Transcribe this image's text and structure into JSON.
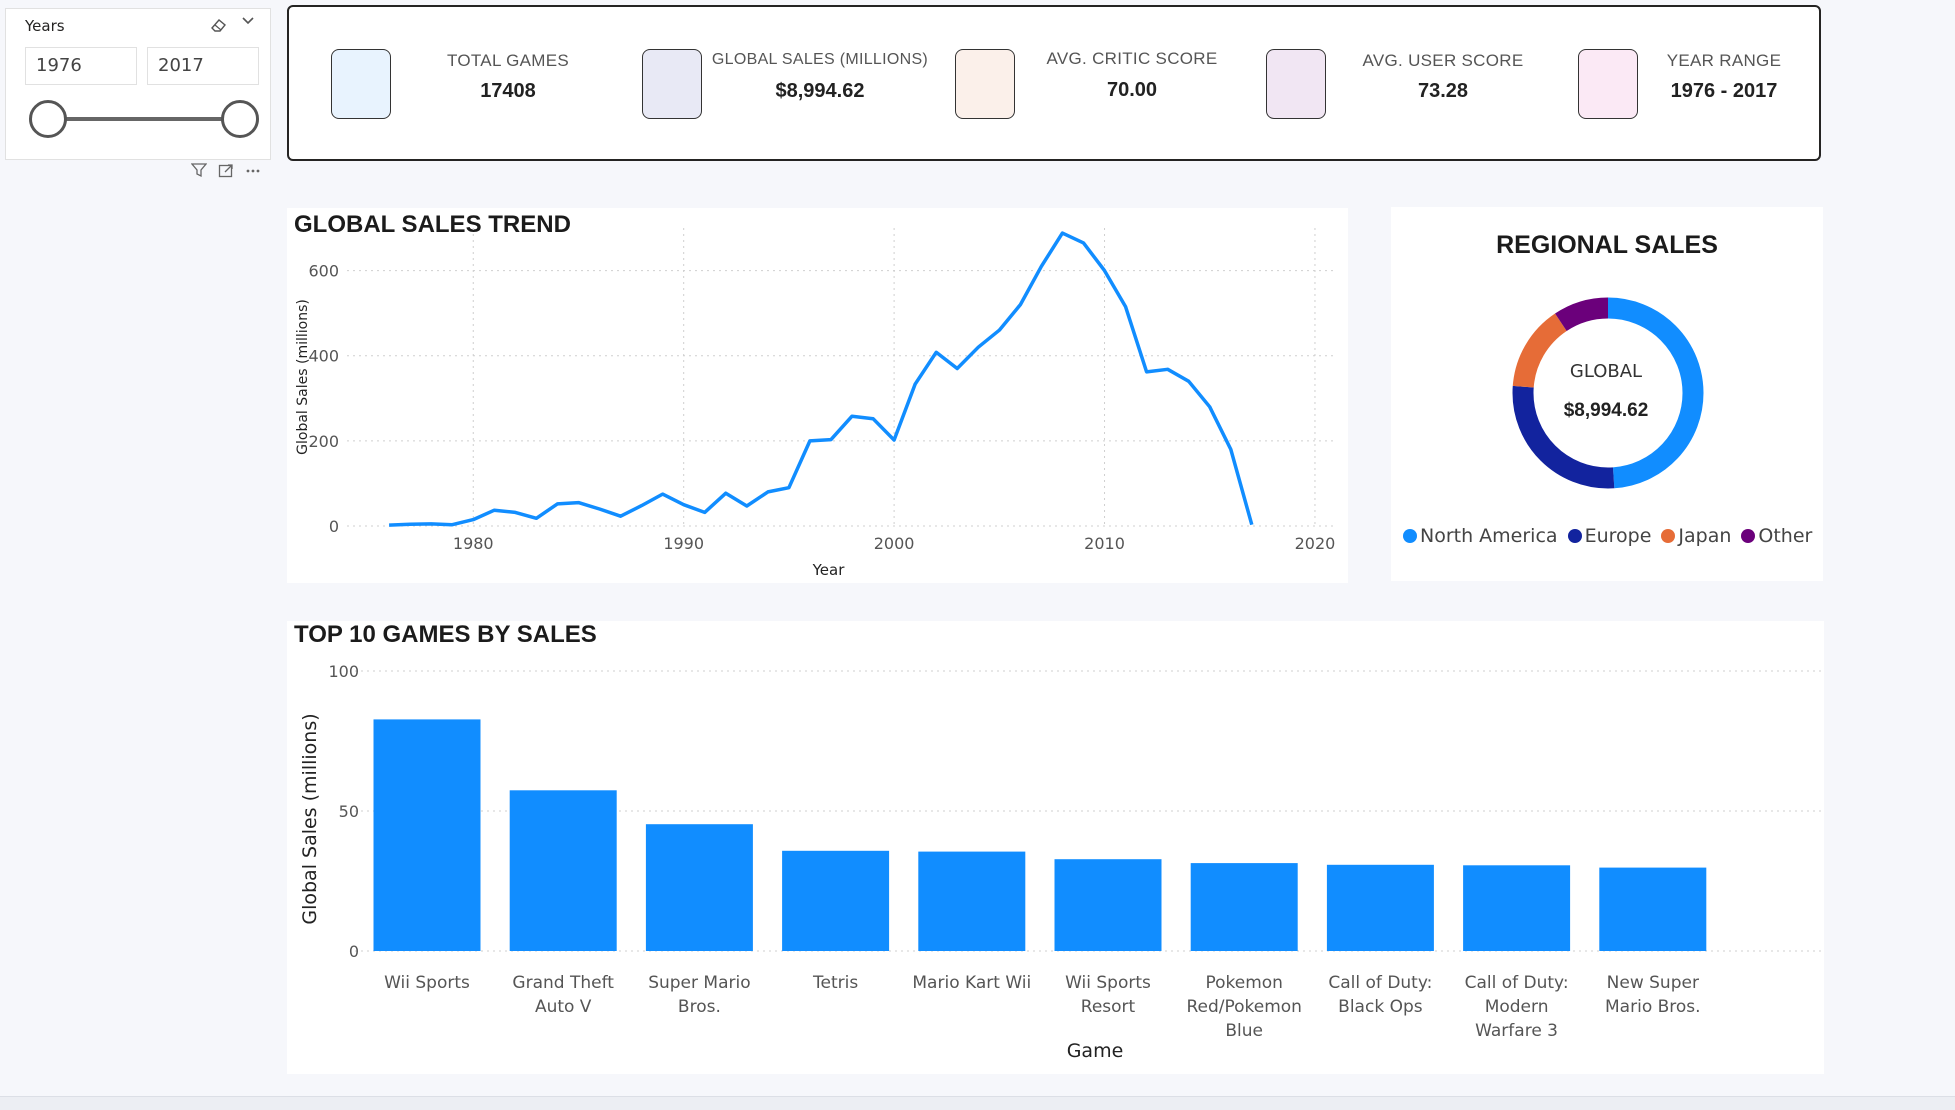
{
  "slicer": {
    "title": "Years",
    "start_value": "1976",
    "end_value": "2017",
    "icons": [
      "eraser-icon",
      "chevron-down-icon",
      "filter-icon",
      "focus-mode-icon",
      "more-options-icon"
    ]
  },
  "kpis": [
    {
      "label": "TOTAL GAMES",
      "value": "17408",
      "swatch_color": "#e8f3fe"
    },
    {
      "label": "GLOBAL SALES (MILLIONS)",
      "value": "$8,994.62",
      "swatch_color": "#e8e9f5"
    },
    {
      "label": "AVG. CRITIC SCORE",
      "value": "70.00",
      "swatch_color": "#fbf0ea"
    },
    {
      "label": "AVG. USER SCORE",
      "value": "73.28",
      "swatch_color": "#f1e6f3"
    },
    {
      "label": "YEAR RANGE",
      "value": "1976 - 2017",
      "swatch_color": "#fbe9f5"
    }
  ],
  "line_chart": {
    "title": "GLOBAL SALES TREND",
    "chart_data": {
      "type": "line",
      "xlabel": "Year",
      "ylabel": "Global Sales (millions)",
      "xlim": [
        1974,
        2021
      ],
      "ylim": [
        0,
        700
      ],
      "x_ticks": [
        "1980",
        "1990",
        "2000",
        "2010",
        "2020"
      ],
      "y_ticks": [
        "0",
        "200",
        "400",
        "600"
      ],
      "grid": true,
      "color": "#118dff",
      "x": [
        1976,
        1977,
        1978,
        1979,
        1980,
        1981,
        1982,
        1983,
        1984,
        1985,
        1986,
        1987,
        1988,
        1989,
        1990,
        1991,
        1992,
        1993,
        1994,
        1995,
        1996,
        1997,
        1998,
        1999,
        2000,
        2001,
        2002,
        2003,
        2004,
        2005,
        2006,
        2007,
        2008,
        2009,
        2010,
        2011,
        2012,
        2013,
        2014,
        2015,
        2016,
        2017
      ],
      "values": [
        2,
        4,
        5,
        3,
        15,
        37,
        32,
        18,
        52,
        55,
        40,
        23,
        48,
        75,
        50,
        32,
        77,
        47,
        80,
        90,
        200,
        203,
        258,
        252,
        202,
        333,
        408,
        370,
        420,
        460,
        520,
        610,
        688,
        665,
        600,
        515,
        362,
        368,
        340,
        280,
        180,
        3
      ]
    }
  },
  "donut_chart": {
    "title": "REGIONAL SALES",
    "center_label": "GLOBAL",
    "center_value": "$8,994.62",
    "chart_data": {
      "type": "pie",
      "categories": [
        "North America",
        "Europe",
        "Japan",
        "Other"
      ],
      "values": [
        4400,
        2450,
        1300,
        845
      ],
      "colors": [
        "#118dff",
        "#12239e",
        "#e66c37",
        "#6b007b"
      ],
      "legend": "bottom"
    }
  },
  "bar_chart": {
    "title": "TOP 10 GAMES BY SALES",
    "chart_data": {
      "type": "bar",
      "xlabel": "Game",
      "ylabel": "Global Sales (millions)",
      "ylim": [
        0,
        100
      ],
      "y_ticks": [
        "0",
        "50",
        "100"
      ],
      "grid": true,
      "color": "#118dff",
      "categories": [
        "Wii Sports",
        "Grand Theft Auto V",
        "Super Mario Bros.",
        "Tetris",
        "Mario Kart Wii",
        "Wii Sports Resort",
        "Pokemon Red/Pokemon Blue",
        "Call of Duty: Black Ops",
        "Call of Duty: Modern Warfare 3",
        "New Super Mario Bros."
      ],
      "category_lines": [
        [
          "Wii Sports"
        ],
        [
          "Grand Theft",
          "Auto V"
        ],
        [
          "Super Mario",
          "Bros."
        ],
        [
          "Tetris"
        ],
        [
          "Mario Kart Wii"
        ],
        [
          "Wii Sports",
          "Resort"
        ],
        [
          "Pokemon",
          "Red/Pokemon",
          "Blue"
        ],
        [
          "Call of Duty:",
          "Black Ops"
        ],
        [
          "Call of Duty:",
          "Modern",
          "Warfare 3"
        ],
        [
          "New Super",
          "Mario Bros."
        ]
      ],
      "values": [
        82.7,
        57.4,
        45.3,
        35.8,
        35.5,
        32.8,
        31.4,
        30.8,
        30.6,
        29.8
      ]
    }
  }
}
